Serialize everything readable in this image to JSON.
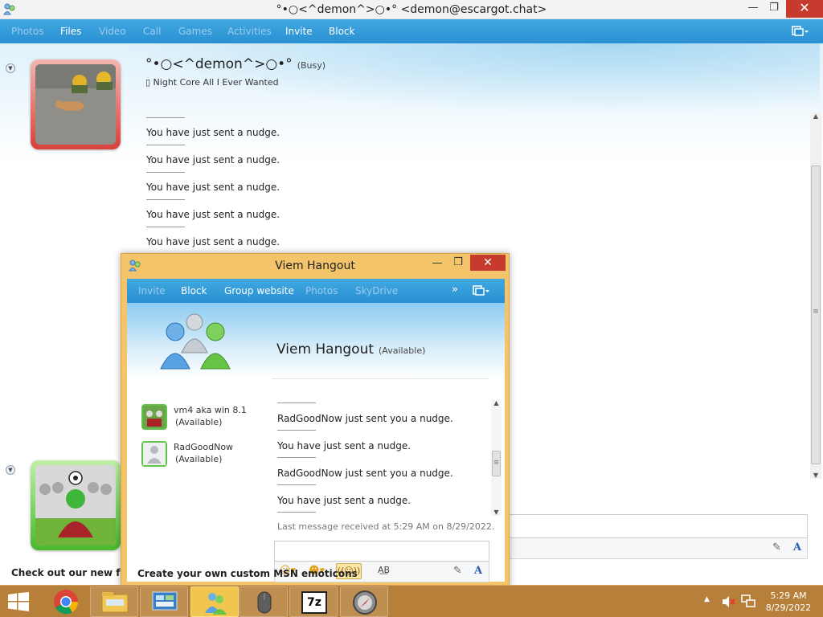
{
  "main": {
    "title": "°•○<^demon^>○•° <demon@escargot.chat>",
    "menu": [
      {
        "label": "Photos",
        "enabled": false
      },
      {
        "label": "Files",
        "enabled": true
      },
      {
        "label": "Video",
        "enabled": false
      },
      {
        "label": "Call",
        "enabled": false
      },
      {
        "label": "Games",
        "enabled": false
      },
      {
        "label": "Activities",
        "enabled": false
      },
      {
        "label": "Invite",
        "enabled": true
      },
      {
        "label": "Block",
        "enabled": true
      }
    ],
    "contact_name": "°•○<^demon^>○•°",
    "contact_status": "(Busy)",
    "contact_psm": "▯ Night Core All I Ever Wanted",
    "messages": [
      "You have just sent a nudge.",
      "You have just sent a nudge.",
      "You have just sent a nudge.",
      "You have just sent a nudge.",
      "You have just sent a nudge."
    ],
    "footer_left": "Check out our new foru",
    "footer_right": "Create your own custom MSN emoticons"
  },
  "hangout": {
    "title": "Viem Hangout",
    "menu": [
      {
        "label": "Invite",
        "enabled": false
      },
      {
        "label": "Block",
        "enabled": true
      },
      {
        "label": "Group website",
        "enabled": true
      },
      {
        "label": "Photos",
        "enabled": false
      },
      {
        "label": "SkyDrive",
        "enabled": false
      }
    ],
    "more_glyph": "»",
    "name": "Viem Hangout",
    "status": "(Available)",
    "members": [
      {
        "name": "vm4 aka win 8.1",
        "status": "(Available)"
      },
      {
        "name": "RadGoodNow",
        "status": "(Available)"
      }
    ],
    "messages": [
      "RadGoodNow just sent you a nudge.",
      "You have just sent a nudge.",
      "RadGoodNow just sent you a nudge.",
      "You have just sent a nudge."
    ],
    "last_message": "Last message received at 5:29 AM on 8/29/2022."
  },
  "taskbar": {
    "time": "5:29 AM",
    "date": "8/29/2022",
    "apps": [
      "start",
      "chrome",
      "file-explorer",
      "control-panel",
      "messenger",
      "mouse",
      "7zip",
      "compass"
    ]
  },
  "glyphs": {
    "minimize": "—",
    "maximize": "❐",
    "close": "✕",
    "collapse": "▼",
    "up_arrow": "▲",
    "down_arrow": "▼",
    "scroll_grip": "≡",
    "sevenzip": "7z"
  },
  "colors": {
    "menubar": "#2a90d3",
    "close_button": "#c73a2e",
    "hangout_frame": "#f3c46a",
    "taskbar": "#b7803a"
  }
}
